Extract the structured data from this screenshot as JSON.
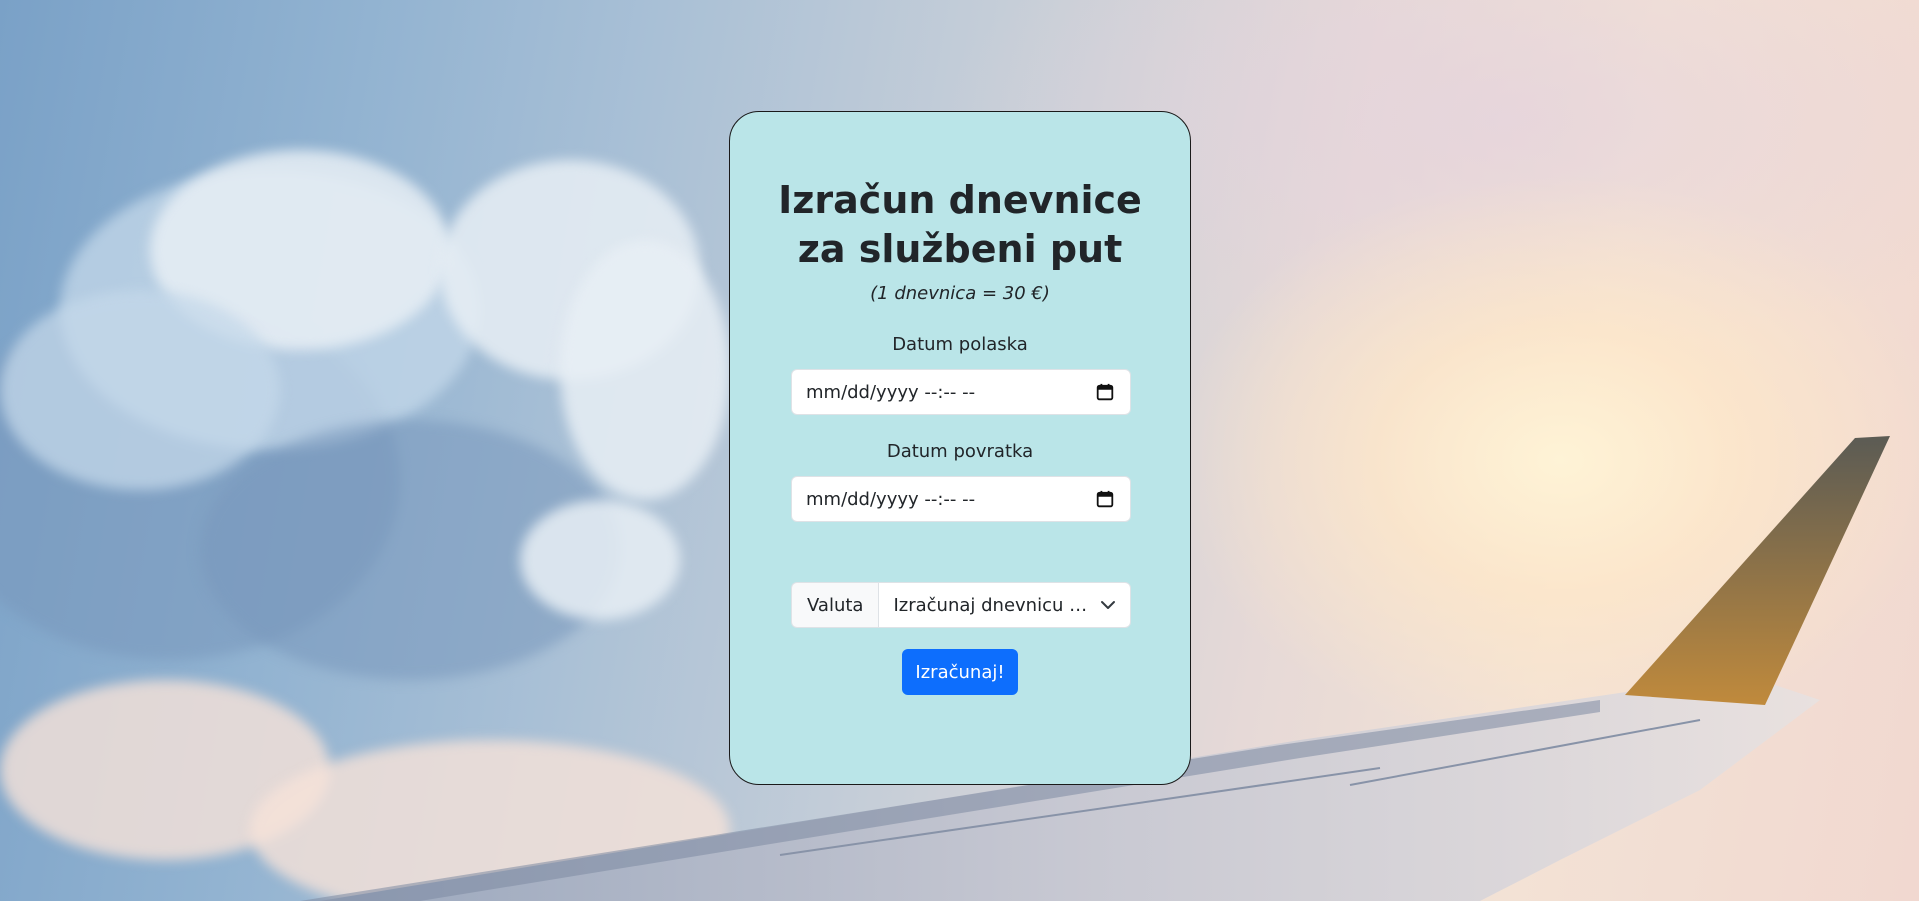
{
  "form": {
    "title_line1": "Izračun dnevnice",
    "title_line2": "za službeni put",
    "subtitle": "(1 dnevnica = 30 €)",
    "departure": {
      "label": "Datum polaska",
      "placeholder": "mm/dd/yyyy --:-- --",
      "icon": "calendar-icon"
    },
    "return": {
      "label": "Datum povratka",
      "placeholder": "mm/dd/yyyy --:-- --",
      "icon": "calendar-icon"
    },
    "currency": {
      "addon_label": "Valuta",
      "selected": "Izračunaj dnevnicu u...",
      "icon": "chevron-down-icon"
    },
    "submit_label": "Izračunaj!"
  },
  "colors": {
    "card_background": "#bae5e8",
    "button_primary": "#0d6efd",
    "text": "#212529"
  }
}
